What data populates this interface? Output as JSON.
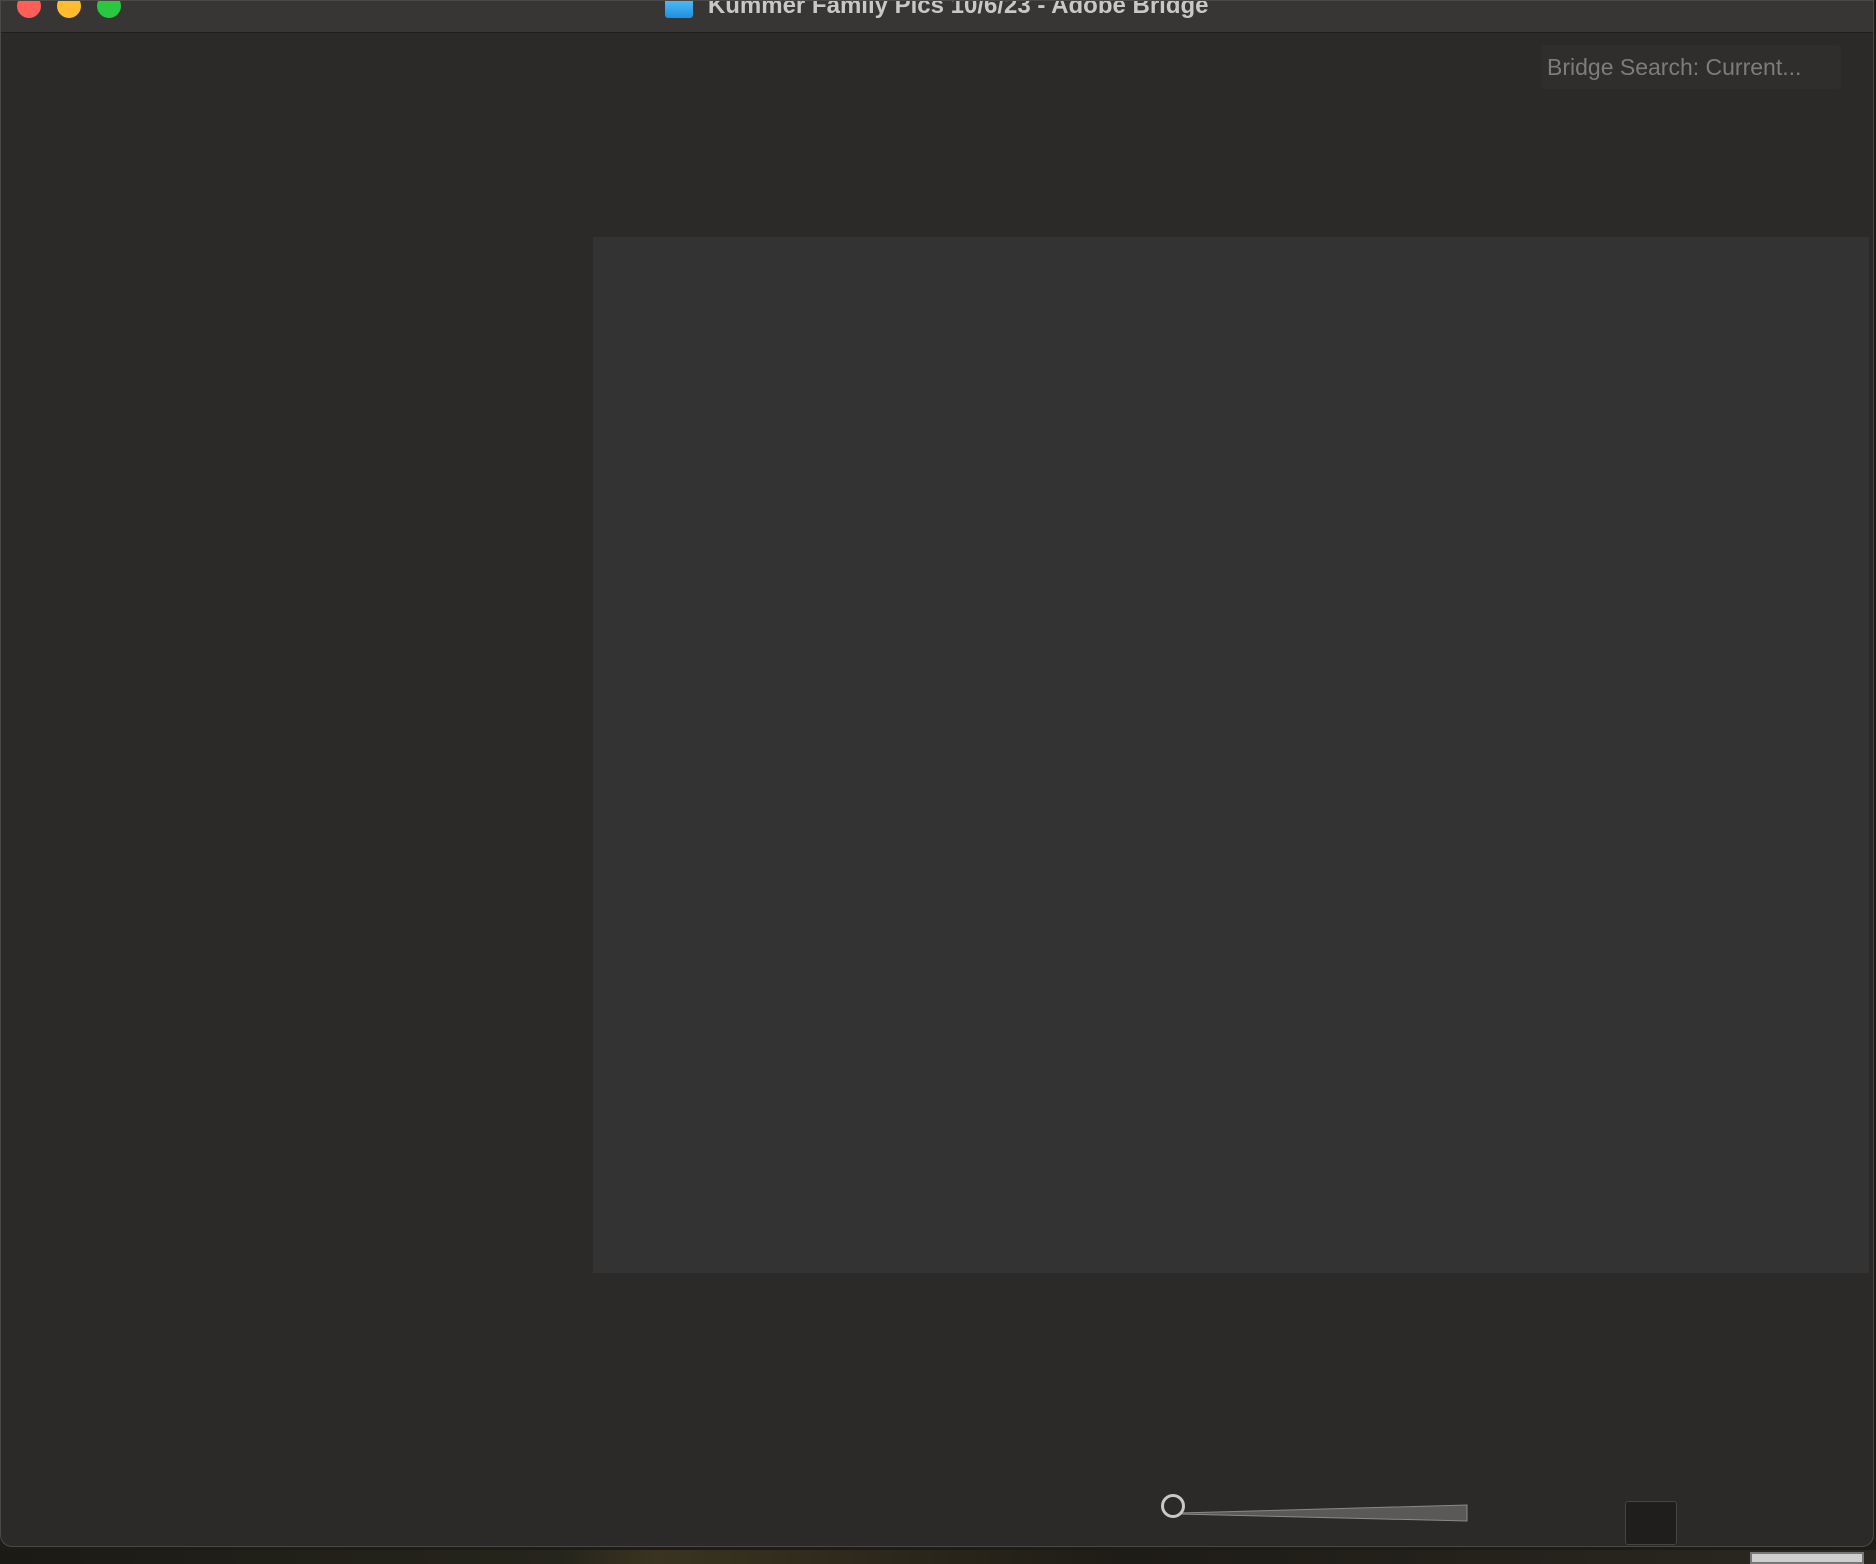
{
  "window": {
    "title": "Kummer Family Pics 10/6/23 - Adobe Bridge",
    "title_icon": "adobe-bridge-folder-icon"
  },
  "search": {
    "placeholder": "Bridge Search: Current..."
  },
  "thumbnail_slider": {
    "level": 0
  },
  "colors": {
    "window_bg": "#2b2a28",
    "panel_bg": "#333333",
    "close": "#ff5f57",
    "minimize": "#febc2e",
    "maximize": "#28c840"
  }
}
